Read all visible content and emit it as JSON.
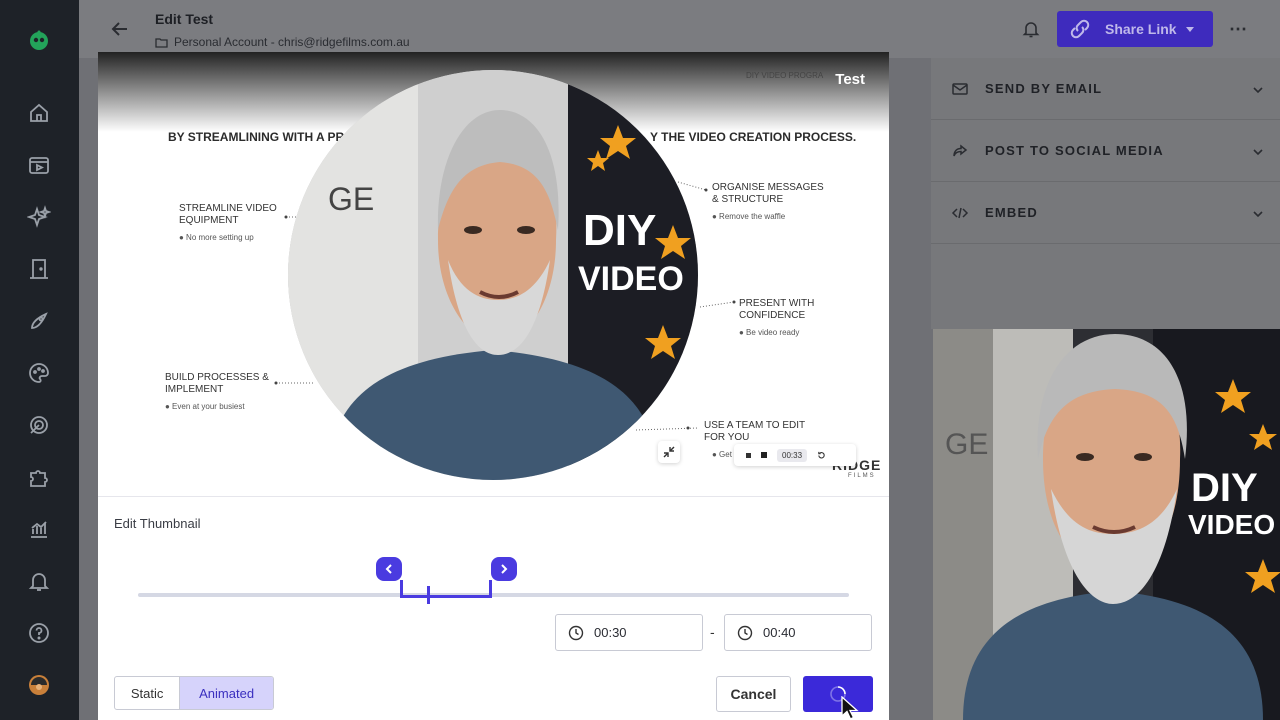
{
  "header": {
    "title": "Edit Test",
    "subtitle": "Personal Account - chris@ridgefilms.com.au",
    "share_label": "Share Link",
    "more": "⋯"
  },
  "right_panel": {
    "items": [
      {
        "label": "SEND BY EMAIL",
        "icon": "mail-icon"
      },
      {
        "label": "POST TO SOCIAL MEDIA",
        "icon": "share-icon"
      },
      {
        "label": "EMBED",
        "icon": "code-icon"
      }
    ]
  },
  "video": {
    "title": "Test",
    "brand_text": "DIY VIDEO PROGRA",
    "headline_left": "BY STREAMLINING WITH A PRO",
    "headline_right": "Y THE VIDEO CREATION PROCESS.",
    "points": [
      {
        "head": "STREAMLINE VIDEO EQUIPMENT",
        "sub": "● No more setting up"
      },
      {
        "head": "BUILD PROCESSES & IMPLEMENT",
        "sub": "● Even at your busiest"
      },
      {
        "head": "ORGANISE MESSAGES & STRUCTURE",
        "sub": "● Remove the waffle"
      },
      {
        "head": "PRESENT WITH CONFIDENCE",
        "sub": "● Be video ready"
      },
      {
        "head": "USE A TEAM TO EDIT FOR YOU",
        "sub": "● Get be"
      }
    ],
    "ridge_logo": "RIDGE",
    "ridge_logo_sub": "FILMS",
    "control_time": "00:33"
  },
  "thumbnail": {
    "label": "Edit Thumbnail",
    "start_time": "00:30",
    "end_time": "00:40",
    "separator": "-"
  },
  "mode": {
    "static_label": "Static",
    "animated_label": "Animated",
    "selected": "Animated"
  },
  "actions": {
    "cancel_label": "Cancel"
  },
  "colors": {
    "accent": "#4a3be0",
    "share_button": "#3e2bbd",
    "rail": "#1e2228"
  }
}
